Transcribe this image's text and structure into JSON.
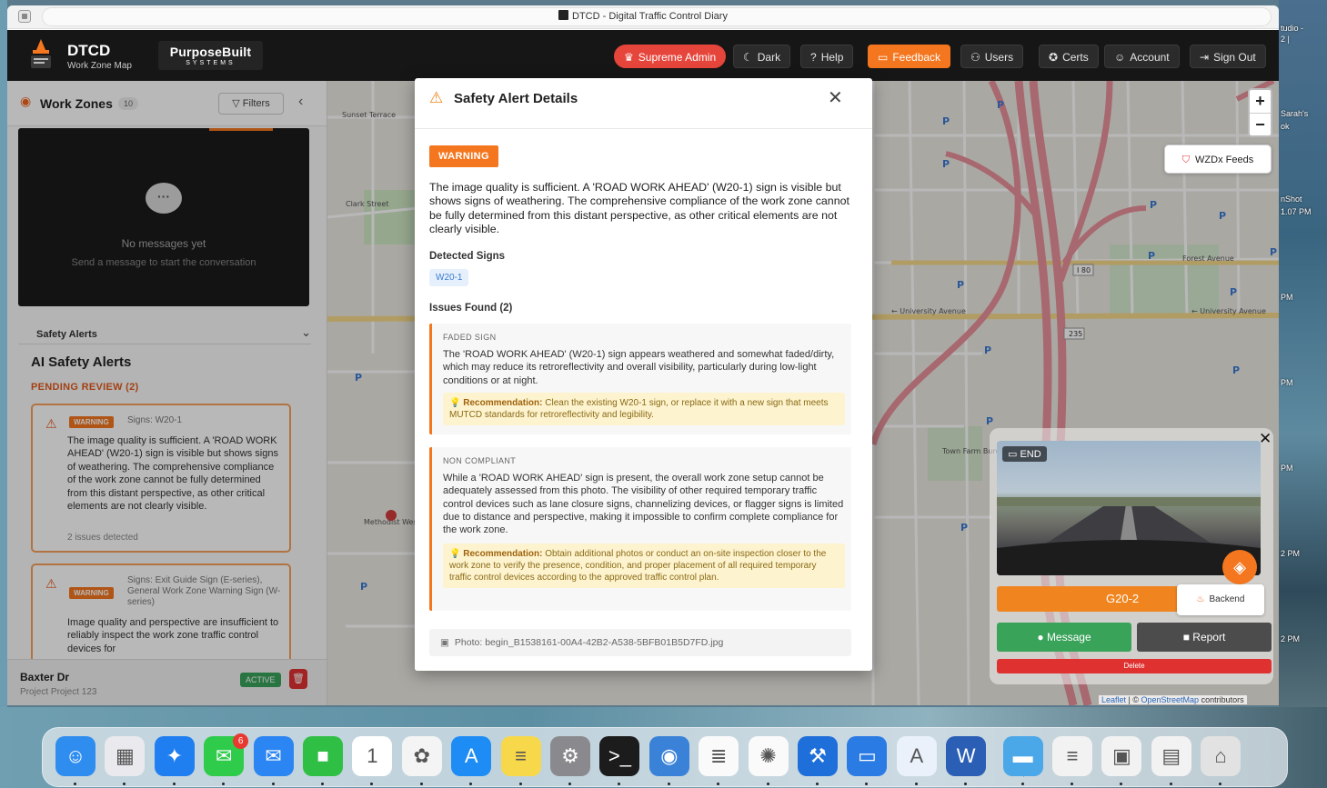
{
  "window": {
    "title": "DTCD - Digital Traffic Control Diary"
  },
  "header": {
    "brand": "DTCD",
    "subtitle": "Work Zone Map",
    "partner_top": "PurposeBuilt",
    "partner_bottom": "SYSTEMS",
    "buttons": [
      {
        "label": "Supreme Admin",
        "icon": "crown-icon"
      },
      {
        "label": "Dark",
        "icon": "moon-icon"
      },
      {
        "label": "Help",
        "icon": "help-icon"
      },
      {
        "label": "Feedback",
        "icon": "comment-icon"
      },
      {
        "label": "Users",
        "icon": "users-icon"
      },
      {
        "label": "Certs",
        "icon": "ribbon-icon"
      },
      {
        "label": "Account",
        "icon": "user-icon"
      },
      {
        "label": "Sign Out",
        "icon": "logout-icon"
      }
    ]
  },
  "sidebar": {
    "title": "Work Zones",
    "count": "10",
    "filters_label": "Filters",
    "chat": {
      "empty_title": "No messages yet",
      "empty_hint": "Send a message to start the conversation"
    },
    "safety_section": "Safety Alerts",
    "ai_title": "AI Safety Alerts",
    "pending_label": "PENDING REVIEW (2)",
    "alerts": [
      {
        "badge": "WARNING",
        "signs": "Signs: W20-1",
        "text": "The image quality is sufficient. A 'ROAD WORK AHEAD' (W20-1) sign is visible but shows signs of weathering. The comprehensive compliance of the work zone cannot be fully determined from this distant perspective, as other critical elements are not clearly visible.",
        "issues": "2 issues detected"
      },
      {
        "badge": "WARNING",
        "signs": "Signs: Exit Guide Sign (E-series), General Work Zone Warning Sign (W-series)",
        "text": "Image quality and perspective are insufficient to reliably inspect the work zone traffic control devices for"
      }
    ],
    "footer": {
      "name": "Baxter Dr",
      "project": "Project Project 123",
      "status": "ACTIVE"
    }
  },
  "modal": {
    "title": "Safety Alert Details",
    "severity": "WARNING",
    "description": "The image quality is sufficient. A 'ROAD WORK AHEAD' (W20-1) sign is visible but shows signs of weathering. The comprehensive compliance of the work zone cannot be fully determined from this distant perspective, as other critical elements are not clearly visible.",
    "detected_label": "Detected Signs",
    "detected_signs": [
      "W20-1"
    ],
    "issues_label": "Issues Found (2)",
    "issues": [
      {
        "type": "FADED SIGN",
        "description": "The 'ROAD WORK AHEAD' (W20-1) sign appears weathered and somewhat faded/dirty, which may reduce its retroreflectivity and overall visibility, particularly during low-light conditions or at night.",
        "rec_label": "Recommendation:",
        "recommendation": "Clean the existing W20-1 sign, or replace it with a new sign that meets MUTCD standards for retroreflectivity and legibility."
      },
      {
        "type": "NON COMPLIANT",
        "description": "While a 'ROAD WORK AHEAD' sign is present, the overall work zone setup cannot be adequately assessed from this photo. The visibility of other required temporary traffic control devices such as lane closure signs, channelizing devices, or flagger signs is limited due to distance and perspective, making it impossible to confirm complete compliance for the work zone.",
        "rec_label": "Recommendation:",
        "recommendation": "Obtain additional photos or conduct an on-site inspection closer to the work zone to verify the presence, condition, and proper placement of all required temporary traffic control devices according to the approved traffic control plan."
      }
    ],
    "photo": "Photo: begin_B1538161-00A4-42B2-A538-5BFB01B5D7FD.jpg"
  },
  "map": {
    "zoom_in": "+",
    "zoom_out": "−",
    "wzdx_label": "WZDx Feeds",
    "labels": {
      "university_w": "University Avenue",
      "university_e": "University Avenue",
      "forest": "Forest Avenue",
      "clark": "Clark Street",
      "sunset": "Sunset Terrace",
      "hospital": "Methodist West Hospital",
      "town": "Town Farm Bureau",
      "i80": "I 80",
      "i235": "235"
    },
    "camera": {
      "end_label": "END",
      "bar_label": "G20-2",
      "backend_label": "Backend",
      "message_label": "Message",
      "report_label": "Report",
      "delete_label": "Delete"
    },
    "attribution_leaflet": "Leaflet",
    "attribution_osm": "OpenStreetMap",
    "attribution_suffix": "contributors"
  },
  "desktop": {
    "right_clips": [
      "tudio -",
      "2 |",
      "Sarah's",
      "ok",
      "nShot",
      "1.07 PM",
      "PM",
      "PM",
      "PM",
      "2 PM",
      "2 PM"
    ]
  },
  "dock": {
    "apps": [
      {
        "name": "finder-icon",
        "glyph": "☺",
        "color": "#2f8df0"
      },
      {
        "name": "launchpad-icon",
        "glyph": "▦",
        "color": "#e9e9ee"
      },
      {
        "name": "safari-icon",
        "glyph": "✦",
        "color": "#1f7ef0"
      },
      {
        "name": "messages-icon",
        "glyph": "✉",
        "color": "#2fcb4b",
        "badge": "6"
      },
      {
        "name": "mail-icon",
        "glyph": "✉",
        "color": "#2b85f2"
      },
      {
        "name": "facetime-icon",
        "glyph": "■",
        "color": "#2fbf45"
      },
      {
        "name": "calendar-icon",
        "glyph": "1",
        "color": "#ffffff"
      },
      {
        "name": "photos-icon",
        "glyph": "✿",
        "color": "#f4f4f4"
      },
      {
        "name": "app-store-icon",
        "glyph": "A",
        "color": "#1d8df5"
      },
      {
        "name": "notes-icon",
        "glyph": "≡",
        "color": "#f8d84b"
      },
      {
        "name": "settings-icon",
        "glyph": "⚙",
        "color": "#8a8a8e"
      },
      {
        "name": "terminal-icon",
        "glyph": ">_",
        "color": "#1c1c1c"
      },
      {
        "name": "docker-icon",
        "glyph": "◉",
        "color": "#3a82d8"
      },
      {
        "name": "textedit-icon",
        "glyph": "≣",
        "color": "#fafafa"
      },
      {
        "name": "chatgpt-icon",
        "glyph": "✺",
        "color": "#fafafa"
      },
      {
        "name": "xcode-icon",
        "glyph": "⚒",
        "color": "#1e6fd9"
      },
      {
        "name": "simulator-icon",
        "glyph": "▭",
        "color": "#2a7be4"
      },
      {
        "name": "instruments-icon",
        "glyph": "A",
        "color": "#eaf1fb"
      },
      {
        "name": "word-icon",
        "glyph": "W",
        "color": "#2b5fb5"
      },
      {
        "name": "downloads-folder-icon",
        "glyph": "▬",
        "color": "#4aa7e8"
      },
      {
        "name": "document-icon",
        "glyph": "≡",
        "color": "#f2f2f2"
      },
      {
        "name": "image-file-icon",
        "glyph": "▣",
        "color": "#f2f2f2"
      },
      {
        "name": "screenshot-file-icon",
        "glyph": "▤",
        "color": "#f2f2f2"
      },
      {
        "name": "trash-icon",
        "glyph": "⌂",
        "color": "#e2e2e2"
      }
    ]
  }
}
